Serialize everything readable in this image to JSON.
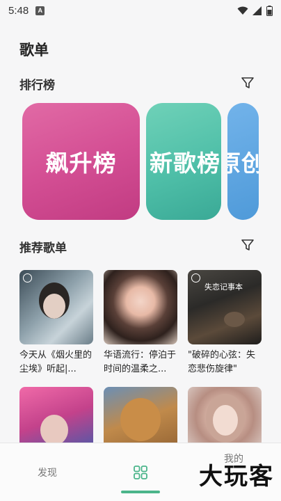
{
  "status_bar": {
    "time": "5:48",
    "badge": "A",
    "icons": [
      "wifi-icon",
      "signal-icon",
      "battery-icon"
    ]
  },
  "page": {
    "title": "歌单"
  },
  "ranking": {
    "title": "排行榜",
    "filter_icon": "filter-icon",
    "cards": [
      {
        "label": "飙升榜",
        "color": "#d44f94"
      },
      {
        "label": "新歌榜",
        "color": "#4fbfa8"
      },
      {
        "label": "原创",
        "color": "#4f9ad9"
      }
    ]
  },
  "recommended": {
    "title": "推荐歌单",
    "filter_icon": "filter-icon",
    "playlists": [
      {
        "caption": "今天从《烟火里的尘埃》听起|..."
      },
      {
        "caption": "华语流行：停泊于时间的温柔之..."
      },
      {
        "caption": "\"破碎的心弦：失恋悲伤旋律\"",
        "overlay": "失恋记事本"
      },
      {
        "caption": ""
      },
      {
        "caption": ""
      },
      {
        "caption": ""
      }
    ]
  },
  "tabbar": {
    "tabs": [
      {
        "label": "发现"
      },
      {
        "icon": "grid-icon"
      },
      {
        "label": "我的"
      }
    ],
    "accent": "#4bb58a"
  },
  "watermark": "大玩客"
}
